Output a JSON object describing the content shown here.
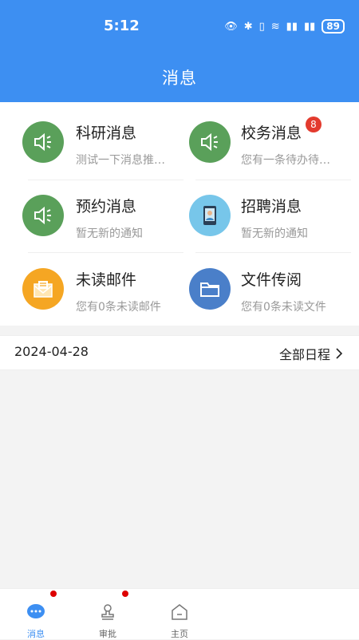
{
  "status": {
    "time": "5:12",
    "battery": "89"
  },
  "header": {
    "title": "消息"
  },
  "messages": [
    {
      "title": "科研消息",
      "subtitle": "测试一下消息推…",
      "icon": "speaker-icon",
      "color": "#5aa05a"
    },
    {
      "title": "校务消息",
      "subtitle": "您有一条待办待…",
      "icon": "speaker-icon",
      "color": "#5aa05a",
      "badge": "8"
    },
    {
      "title": "预约消息",
      "subtitle": "暂无新的通知",
      "icon": "speaker-icon",
      "color": "#5aa05a"
    },
    {
      "title": "招聘消息",
      "subtitle": "暂无新的通知",
      "icon": "tablet-person-icon",
      "color": "#77c6ea"
    },
    {
      "title": "未读邮件",
      "subtitle": "您有0条未读邮件",
      "icon": "mail-icon",
      "color": "#f5a623"
    },
    {
      "title": "文件传阅",
      "subtitle": "您有0条未读文件",
      "icon": "folder-icon",
      "color": "#4a7fc9"
    }
  ],
  "schedule": {
    "date": "2024-04-28",
    "all_label": "全部日程"
  },
  "tabs": [
    {
      "label": "消息",
      "icon": "chat-icon",
      "active": true
    },
    {
      "label": "审批",
      "icon": "stamp-icon",
      "active": false
    },
    {
      "label": "主页",
      "icon": "home-icon",
      "active": false
    }
  ]
}
